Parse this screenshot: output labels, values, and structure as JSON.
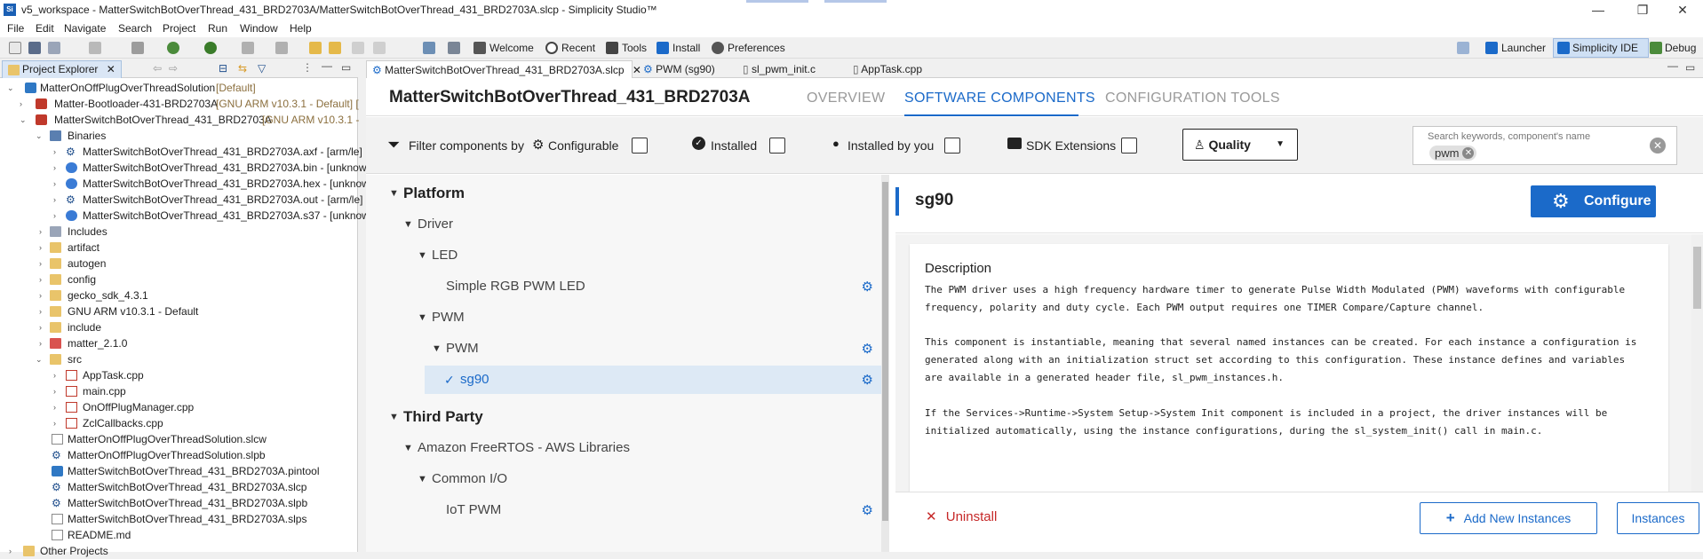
{
  "window": {
    "title": "v5_workspace - MatterSwitchBotOverThread_431_BRD2703A/MatterSwitchBotOverThread_431_BRD2703A.slcp - Simplicity Studio™",
    "app_icon": "Si",
    "minimize": "—",
    "restore": "❐",
    "close": "✕"
  },
  "menu": [
    "File",
    "Edit",
    "Navigate",
    "Search",
    "Project",
    "Run",
    "Window",
    "Help"
  ],
  "toolbar": {
    "welcome": "Welcome",
    "recent": "Recent",
    "tools": "Tools",
    "install": "Install",
    "preferences": "Preferences",
    "launcher": "Launcher",
    "simplicity_ide": "Simplicity IDE",
    "debug": "Debug"
  },
  "explorer": {
    "tab_label": "Project Explorer",
    "items": [
      {
        "label": "MatterOnOffPlugOverThreadSolution",
        "suffix": " [Default]"
      },
      {
        "label": "Matter-Bootloader-431-BRD2703A",
        "suffix": " [GNU ARM v10.3.1 - Default] ["
      },
      {
        "label": "MatterSwitchBotOverThread_431_BRD2703A",
        "suffix": " [GNU ARM v10.3.1 - "
      },
      {
        "label": "Binaries",
        "suffix": ""
      },
      {
        "label": "MatterSwitchBotOverThread_431_BRD2703A.axf - [arm/le]",
        "suffix": ""
      },
      {
        "label": "MatterSwitchBotOverThread_431_BRD2703A.bin - [unknow",
        "suffix": ""
      },
      {
        "label": "MatterSwitchBotOverThread_431_BRD2703A.hex - [unknow",
        "suffix": ""
      },
      {
        "label": "MatterSwitchBotOverThread_431_BRD2703A.out - [arm/le]",
        "suffix": ""
      },
      {
        "label": "MatterSwitchBotOverThread_431_BRD2703A.s37 - [unknow",
        "suffix": ""
      },
      {
        "label": "Includes",
        "suffix": ""
      },
      {
        "label": "artifact",
        "suffix": ""
      },
      {
        "label": "autogen",
        "suffix": ""
      },
      {
        "label": "config",
        "suffix": ""
      },
      {
        "label": "gecko_sdk_4.3.1",
        "suffix": ""
      },
      {
        "label": "GNU ARM v10.3.1 - Default",
        "suffix": ""
      },
      {
        "label": "include",
        "suffix": ""
      },
      {
        "label": "matter_2.1.0",
        "suffix": ""
      },
      {
        "label": "src",
        "suffix": ""
      },
      {
        "label": "AppTask.cpp",
        "suffix": ""
      },
      {
        "label": "main.cpp",
        "suffix": ""
      },
      {
        "label": "OnOffPlugManager.cpp",
        "suffix": ""
      },
      {
        "label": "ZclCallbacks.cpp",
        "suffix": ""
      },
      {
        "label": "MatterOnOffPlugOverThreadSolution.slcw",
        "suffix": ""
      },
      {
        "label": "MatterOnOffPlugOverThreadSolution.slpb",
        "suffix": ""
      },
      {
        "label": "MatterSwitchBotOverThread_431_BRD2703A.pintool",
        "suffix": ""
      },
      {
        "label": "MatterSwitchBotOverThread_431_BRD2703A.slcp",
        "suffix": ""
      },
      {
        "label": "MatterSwitchBotOverThread_431_BRD2703A.slpb",
        "suffix": ""
      },
      {
        "label": "MatterSwitchBotOverThread_431_BRD2703A.slps",
        "suffix": ""
      },
      {
        "label": "README.md",
        "suffix": ""
      },
      {
        "label": "Other Projects",
        "suffix": ""
      }
    ]
  },
  "editor_tabs": [
    {
      "label": "MatterSwitchBotOverThread_431_BRD2703A.slcp"
    },
    {
      "label": "PWM (sg90)"
    },
    {
      "label": "sl_pwm_init.c"
    },
    {
      "label": "AppTask.cpp"
    }
  ],
  "header": {
    "project_title": "MatterSwitchBotOverThread_431_BRD2703A",
    "nav": [
      "OVERVIEW",
      "SOFTWARE COMPONENTS",
      "CONFIGURATION TOOLS"
    ]
  },
  "filters": {
    "filter_by": "Filter components by",
    "configurable": "Configurable",
    "installed": "Installed",
    "installed_by_you": "Installed by you",
    "sdk_extensions": "SDK Extensions",
    "quality": "Quality",
    "search_placeholder": "Search keywords, component's name",
    "search_chip": "pwm"
  },
  "tree": [
    {
      "label": "Platform",
      "level": 0,
      "bold": true
    },
    {
      "label": "Driver",
      "level": 1
    },
    {
      "label": "LED",
      "level": 2
    },
    {
      "label": "Simple RGB PWM LED",
      "level": 3,
      "leaf": true,
      "configurable": true
    },
    {
      "label": "PWM",
      "level": 2
    },
    {
      "label": "PWM",
      "level": 3
    },
    {
      "label": "sg90",
      "level": 4,
      "leaf": true,
      "configurable": true,
      "installed": true,
      "selected": true
    },
    {
      "label": "Third Party",
      "level": 0,
      "bold": true
    },
    {
      "label": "Amazon FreeRTOS - AWS Libraries",
      "level": 1
    },
    {
      "label": "Common I/O",
      "level": 2
    },
    {
      "label": "IoT PWM",
      "level": 3,
      "leaf": true,
      "configurable": true
    }
  ],
  "detail": {
    "name": "sg90",
    "configure_label": "Configure",
    "description_title": "Description",
    "lines": [
      "The PWM driver uses a high frequency hardware timer to generate Pulse Width Modulated (PWM) waveforms with configurable",
      "frequency, polarity and duty  cycle. Each PWM output requires one TIMER Compare/Capture channel.",
      "",
      "This component is instantiable, meaning that several named instances can be  created. For each instance a configuration is",
      "generated along with an  initialization struct set according to this configuration. These instance defines and variables",
      "are available in a generated header file,  sl_pwm_instances.h.",
      "",
      "If the Services->Runtime->System Setup->System Init component is included in a project, the driver instances will be",
      "initialized automatically, using the instance configurations, during the sl_system_init() call in main.c."
    ],
    "uninstall": "Uninstall",
    "add_new_instances": "Add New Instances",
    "instances": "Instances"
  },
  "colors": {
    "accent": "#1b6ac9",
    "danger": "#c62828",
    "selected_row": "#dde9f5"
  }
}
